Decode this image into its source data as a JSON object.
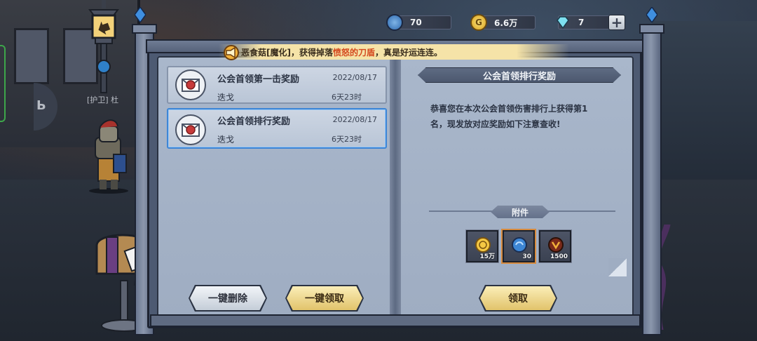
{
  "currencies": [
    {
      "name": "blue-orb",
      "value": "70"
    },
    {
      "name": "gold-coin",
      "value": "6.6万"
    },
    {
      "name": "diamond",
      "value": "7"
    }
  ],
  "side": {
    "guard_label": "[护卫] 杜"
  },
  "notice": {
    "part1": "恶食菇[魔化]，获得掉落",
    "highlight": "愤怒的刀盾",
    "part2": "，真是好运连连。"
  },
  "mails": [
    {
      "title": "公会首领第一击奖励",
      "date": "2022/08/17",
      "sender": "迭戈",
      "remaining": "6天23时",
      "selected": false
    },
    {
      "title": "公会首领排行奖励",
      "date": "2022/08/17",
      "sender": "迭戈",
      "remaining": "6天23时",
      "selected": true
    }
  ],
  "buttons": {
    "delete_all": "一键删除",
    "claim_all": "一键领取",
    "claim": "领取"
  },
  "detail": {
    "title": "公会首领排行奖励",
    "body": "恭喜您在本次公会首领伤害排行上获得第1名，现发放对应奖励如下注意查收!",
    "attachments_label": "附件",
    "attachments": [
      {
        "icon": "gold-coin-icon",
        "count": "15万"
      },
      {
        "icon": "blue-orb-icon",
        "count": "30"
      },
      {
        "icon": "rune-icon",
        "count": "1500"
      }
    ]
  },
  "colors": {
    "accent_gold": "#e1c36b",
    "notice_red": "#d4481e",
    "selected_border": "#3e86d6"
  }
}
